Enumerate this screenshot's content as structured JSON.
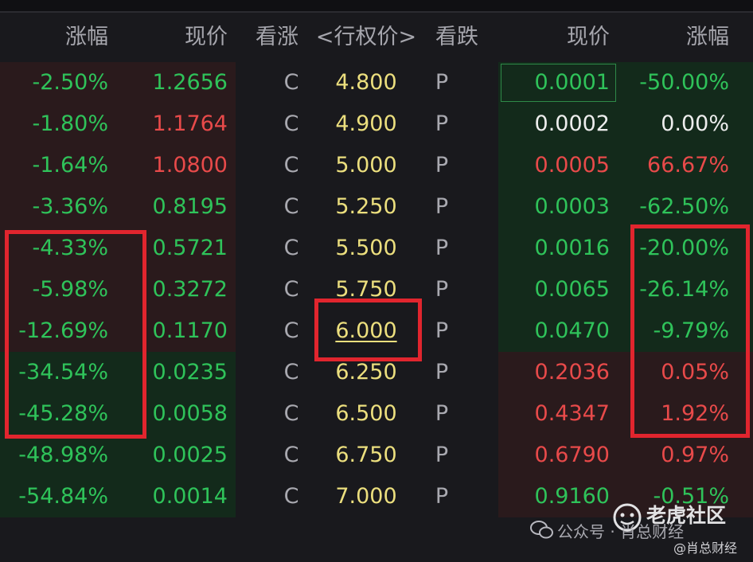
{
  "headers": {
    "call_change": "涨幅",
    "call_price": "现价",
    "call": "看涨",
    "strike": "<行权价>",
    "put": "看跌",
    "put_price": "现价",
    "put_change": "涨幅"
  },
  "rows": [
    {
      "call_change": "-2.50%",
      "call_price": "1.2656",
      "call_label": "C",
      "strike": "4.800",
      "put_label": "P",
      "put_price": "0.0001",
      "put_change": "-50.00%"
    },
    {
      "call_change": "-1.80%",
      "call_price": "1.1764",
      "call_label": "C",
      "strike": "4.900",
      "put_label": "P",
      "put_price": "0.0002",
      "put_change": "0.00%"
    },
    {
      "call_change": "-1.64%",
      "call_price": "1.0800",
      "call_label": "C",
      "strike": "5.000",
      "put_label": "P",
      "put_price": "0.0005",
      "put_change": "66.67%"
    },
    {
      "call_change": "-3.36%",
      "call_price": "0.8195",
      "call_label": "C",
      "strike": "5.250",
      "put_label": "P",
      "put_price": "0.0003",
      "put_change": "-62.50%"
    },
    {
      "call_change": "-4.33%",
      "call_price": "0.5721",
      "call_label": "C",
      "strike": "5.500",
      "put_label": "P",
      "put_price": "0.0016",
      "put_change": "-20.00%"
    },
    {
      "call_change": "-5.98%",
      "call_price": "0.3272",
      "call_label": "C",
      "strike": "5.750",
      "put_label": "P",
      "put_price": "0.0065",
      "put_change": "-26.14%"
    },
    {
      "call_change": "-12.69%",
      "call_price": "0.1170",
      "call_label": "C",
      "strike": "6.000",
      "put_label": "P",
      "put_price": "0.0470",
      "put_change": "-9.79%"
    },
    {
      "call_change": "-34.54%",
      "call_price": "0.0235",
      "call_label": "C",
      "strike": "6.250",
      "put_label": "P",
      "put_price": "0.2036",
      "put_change": "0.05%"
    },
    {
      "call_change": "-45.28%",
      "call_price": "0.0058",
      "call_label": "C",
      "strike": "6.500",
      "put_label": "P",
      "put_price": "0.4347",
      "put_change": "1.92%"
    },
    {
      "call_change": "-48.98%",
      "call_price": "0.0025",
      "call_label": "C",
      "strike": "6.750",
      "put_label": "P",
      "put_price": "0.6790",
      "put_change": "0.97%"
    },
    {
      "call_change": "-54.84%",
      "call_price": "0.0014",
      "call_label": "C",
      "strike": "7.000",
      "put_label": "P",
      "put_price": "0.9160",
      "put_change": "-0.51%"
    }
  ],
  "watermark": {
    "title": "老虎社区",
    "subtitle": "公众号 · 肖总财经",
    "handle": "@肖总财经"
  },
  "colors": {
    "up": "#e84a4a",
    "down": "#2fc35a",
    "flat": "#ededed",
    "strike": "#ecdf7e",
    "itm_red_bg": "#2a1a1c",
    "itm_green_bg": "#132a1b",
    "annotation_box": "#e1252e"
  }
}
